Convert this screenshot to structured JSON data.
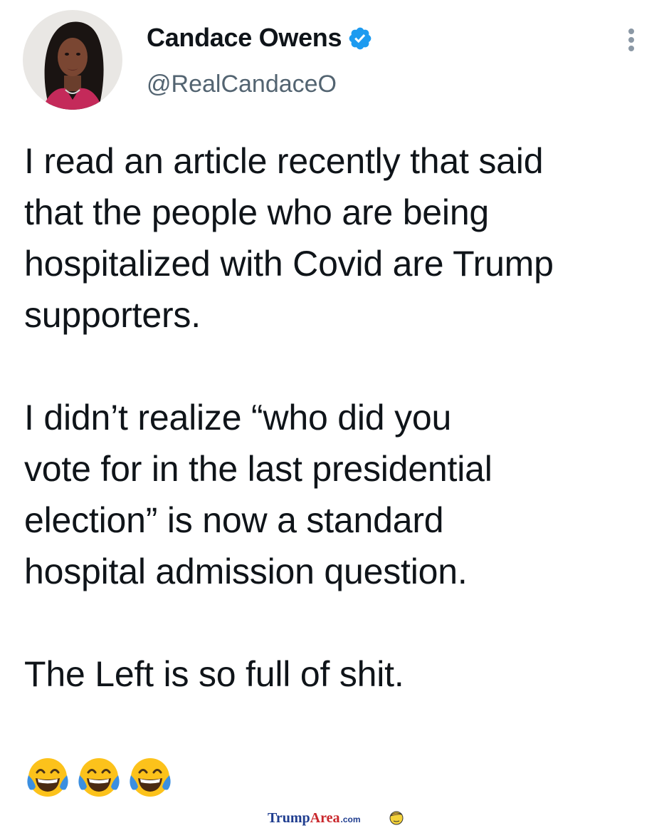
{
  "header": {
    "display_name": "Candace Owens",
    "handle": "@RealCandaceO",
    "verified_icon": "verified-badge-icon",
    "more_icon": "more-vertical-icon"
  },
  "tweet": {
    "lines": [
      "I read an article recently that said",
      "that the people who are being",
      "hospitalized with Covid are Trump",
      "supporters.",
      "",
      "I didn’t realize “who did you",
      "vote for in the last presidential",
      "election” is now a standard",
      "hospital admission question.",
      "",
      "The Left is so full of shit."
    ],
    "emoji_icon": "face-with-tears-of-joy-icon",
    "emoji_count": 3
  },
  "watermark": {
    "part1": "Trump",
    "part2": "Area",
    "part3": ".com",
    "icon": "trump-face-icon"
  },
  "colors": {
    "text": "#0f1419",
    "secondary_text": "#536471",
    "verified": "#1d9bf0",
    "watermark_blue": "#1f3d8f",
    "watermark_red": "#c9262b"
  }
}
